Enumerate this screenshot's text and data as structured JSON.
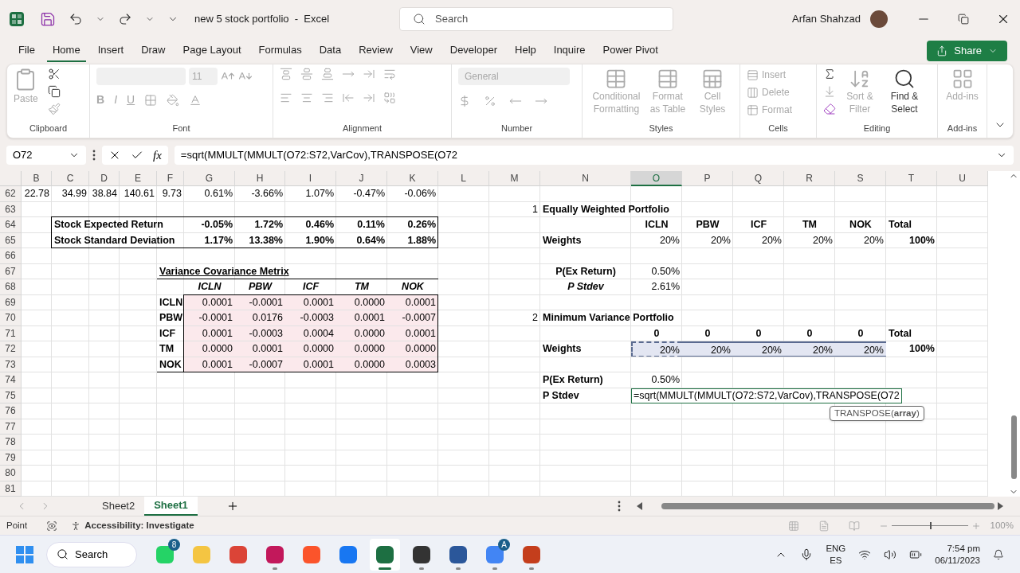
{
  "title_bar": {
    "title": "new 5 stock portfolio  -  Excel",
    "search": {
      "placeholder": "Search"
    },
    "user": "Arfan Shahzad"
  },
  "menu_tabs": [
    {
      "label": "File",
      "selected": false
    },
    {
      "label": "Home",
      "selected": true
    },
    {
      "label": "Insert",
      "selected": false
    },
    {
      "label": "Draw",
      "selected": false
    },
    {
      "label": "Page Layout",
      "selected": false
    },
    {
      "label": "Formulas",
      "selected": false
    },
    {
      "label": "Data",
      "selected": false
    },
    {
      "label": "Review",
      "selected": false
    },
    {
      "label": "View",
      "selected": false
    },
    {
      "label": "Developer",
      "selected": false
    },
    {
      "label": "Help",
      "selected": false
    },
    {
      "label": "Inquire",
      "selected": false
    },
    {
      "label": "Power Pivot",
      "selected": false
    }
  ],
  "share": {
    "label": "Share"
  },
  "ribbon": {
    "clipboard": {
      "label": "Clipboard",
      "paste": {
        "label": "Paste",
        "disabled": true
      }
    },
    "font": {
      "label": "Font",
      "size": "11",
      "bold": "B",
      "italic": "I",
      "underline": "U",
      "disabled": true
    },
    "alignment": {
      "label": "Alignment",
      "disabled": true
    },
    "number": {
      "label": "Number",
      "format": "General",
      "disabled": true
    },
    "styles": {
      "label": "Styles",
      "buttons": [
        {
          "label": "Conditional Formatting",
          "disabled": true
        },
        {
          "label": "Format as Table",
          "disabled": true
        },
        {
          "label": "Cell Styles",
          "disabled": true
        }
      ]
    },
    "cells": {
      "label": "Cells",
      "buttons": [
        {
          "label": "Insert",
          "disabled": true
        },
        {
          "label": "Delete",
          "disabled": true
        },
        {
          "label": "Format",
          "disabled": true
        }
      ]
    },
    "editing": {
      "label": "Editing",
      "buttons": [
        {
          "label": "Sort & Filter",
          "disabled": true
        },
        {
          "label": "Find & Select",
          "disabled": false
        }
      ]
    },
    "addins": {
      "label": "Add-ins",
      "buttons": [
        {
          "label": "Add-ins",
          "disabled": true
        }
      ]
    }
  },
  "formula_bar": {
    "name_box": "O72",
    "function_label": "fx",
    "formula": "=sqrt(MMULT(MMULT(O72:S72,VarCov),TRANSPOSE(O72"
  },
  "grid": {
    "columns": [
      {
        "label": "B",
        "selected": false
      },
      {
        "label": "C",
        "selected": false
      },
      {
        "label": "D",
        "selected": false
      },
      {
        "label": "E",
        "selected": false
      },
      {
        "label": "F",
        "selected": false
      },
      {
        "label": "G",
        "selected": false
      },
      {
        "label": "H",
        "selected": false
      },
      {
        "label": "I",
        "selected": false
      },
      {
        "label": "J",
        "selected": false
      },
      {
        "label": "K",
        "selected": false
      },
      {
        "label": "L",
        "selected": false
      },
      {
        "label": "M",
        "selected": false
      },
      {
        "label": "N",
        "selected": false
      },
      {
        "label": "O",
        "selected": true
      },
      {
        "label": "P",
        "selected": false
      },
      {
        "label": "Q",
        "selected": false
      },
      {
        "label": "R",
        "selected": false
      },
      {
        "label": "S",
        "selected": false
      },
      {
        "label": "T",
        "selected": false
      },
      {
        "label": "U",
        "selected": false
      }
    ],
    "rows": [
      {
        "number": "62",
        "cells": [
          {
            "text": "22.78",
            "kind": "value",
            "selected": false
          },
          {
            "text": "34.99",
            "kind": "value",
            "selected": false
          },
          {
            "text": "38.84",
            "kind": "value",
            "selected": false
          },
          {
            "text": "140.61",
            "kind": "value",
            "selected": false
          },
          {
            "text": "9.73",
            "kind": "value",
            "selected": false
          },
          {
            "text": "0.61%",
            "kind": "value",
            "selected": false
          },
          {
            "text": "-3.66%",
            "kind": "value",
            "selected": false
          },
          {
            "text": "1.07%",
            "kind": "value",
            "selected": false
          },
          {
            "text": "-0.47%",
            "kind": "value",
            "selected": false
          },
          {
            "text": "-0.06%",
            "kind": "value",
            "selected": false
          },
          null,
          null,
          null,
          null,
          null,
          null,
          null,
          null,
          null,
          null
        ]
      },
      {
        "number": "63",
        "cells": [
          null,
          null,
          null,
          null,
          null,
          null,
          null,
          null,
          null,
          null,
          null,
          {
            "text": "1",
            "kind": "value",
            "selected": false
          },
          {
            "text": "Equally Weighted Portfolio",
            "kind": "label",
            "selected": false
          },
          null,
          null,
          null,
          null,
          null,
          null,
          null
        ]
      },
      {
        "number": "64",
        "cells": [
          null,
          {
            "text": "Stock Expected Return",
            "kind": "label",
            "selected": false
          },
          null,
          null,
          null,
          {
            "text": "-0.05%",
            "kind": "bold_value",
            "selected": false
          },
          {
            "text": "1.72%",
            "kind": "bold_value",
            "selected": false
          },
          {
            "text": "0.46%",
            "kind": "bold_value",
            "selected": false
          },
          {
            "text": "0.11%",
            "kind": "bold_value",
            "selected": false
          },
          {
            "text": "0.26%",
            "kind": "bold_value",
            "selected": false
          },
          null,
          null,
          null,
          {
            "text": "ICLN",
            "kind": "center_bold",
            "selected": false
          },
          {
            "text": "PBW",
            "kind": "center_bold",
            "selected": false
          },
          {
            "text": "ICF",
            "kind": "center_bold",
            "selected": false
          },
          {
            "text": "TM",
            "kind": "center_bold",
            "selected": false
          },
          {
            "text": "NOK",
            "kind": "center_bold",
            "selected": false
          },
          {
            "text": "Total",
            "kind": "label",
            "selected": false
          },
          null
        ]
      },
      {
        "number": "65",
        "cells": [
          null,
          {
            "text": "Stock Standard Deviation",
            "kind": "label",
            "selected": false
          },
          null,
          null,
          null,
          {
            "text": "1.17%",
            "kind": "bold_value",
            "selected": false
          },
          {
            "text": "13.38%",
            "kind": "bold_value",
            "selected": false
          },
          {
            "text": "1.90%",
            "kind": "bold_value",
            "selected": false
          },
          {
            "text": "0.64%",
            "kind": "bold_value",
            "selected": false
          },
          {
            "text": "1.88%",
            "kind": "bold_value",
            "selected": false
          },
          null,
          null,
          {
            "text": "Weights",
            "kind": "label",
            "selected": false
          },
          {
            "text": "20%",
            "kind": "value",
            "selected": false
          },
          {
            "text": "20%",
            "kind": "value",
            "selected": false
          },
          {
            "text": "20%",
            "kind": "value",
            "selected": false
          },
          {
            "text": "20%",
            "kind": "value",
            "selected": false
          },
          {
            "text": "20%",
            "kind": "value",
            "selected": false
          },
          {
            "text": "100%",
            "kind": "bold_value",
            "selected": false
          },
          null
        ]
      },
      {
        "number": "66"
      },
      {
        "number": "67",
        "cells": [
          null,
          null,
          null,
          null,
          {
            "text": "Variance Covariance Metrix",
            "kind": "title",
            "selected": false
          },
          null,
          null,
          null,
          null,
          null,
          null,
          null,
          {
            "text": "P(Ex Return)",
            "kind": "center_bold",
            "selected": false
          },
          {
            "text": "0.50%",
            "kind": "value",
            "selected": false
          },
          null,
          null,
          null,
          null,
          null,
          null
        ]
      },
      {
        "number": "68",
        "cells": [
          null,
          null,
          null,
          null,
          null,
          {
            "text": "ICLN",
            "kind": "col_head",
            "selected": false
          },
          {
            "text": "PBW",
            "kind": "col_head",
            "selected": false
          },
          {
            "text": "ICF",
            "kind": "col_head",
            "selected": false
          },
          {
            "text": "TM",
            "kind": "col_head",
            "selected": false
          },
          {
            "text": "NOK",
            "kind": "col_head",
            "selected": false
          },
          null,
          null,
          {
            "text": "P Stdev",
            "kind": "col_head",
            "selected": false
          },
          {
            "text": "2.61%",
            "kind": "value",
            "selected": false
          },
          null,
          null,
          null,
          null,
          null,
          null
        ]
      },
      {
        "number": "69",
        "cells": [
          null,
          null,
          null,
          null,
          {
            "text": "ICLN",
            "kind": "label",
            "selected": false
          },
          {
            "text": "0.0001",
            "kind": "matrix_value",
            "selected": false
          },
          {
            "text": "-0.0001",
            "kind": "matrix_value",
            "selected": false
          },
          {
            "text": "0.0001",
            "kind": "matrix_value",
            "selected": false
          },
          {
            "text": "0.0000",
            "kind": "matrix_value",
            "selected": false
          },
          {
            "text": "0.0001",
            "kind": "matrix_value",
            "selected": false
          },
          null,
          null,
          null,
          null,
          null,
          null,
          null,
          null,
          null,
          null
        ]
      },
      {
        "number": "70",
        "cells": [
          null,
          null,
          null,
          null,
          {
            "text": "PBW",
            "kind": "label",
            "selected": false
          },
          {
            "text": "-0.0001",
            "kind": "matrix_value",
            "selected": false
          },
          {
            "text": "0.0176",
            "kind": "matrix_value",
            "selected": false
          },
          {
            "text": "-0.0003",
            "kind": "matrix_value",
            "selected": false
          },
          {
            "text": "0.0001",
            "kind": "matrix_value",
            "selected": false
          },
          {
            "text": "-0.0007",
            "kind": "matrix_value",
            "selected": false
          },
          null,
          {
            "text": "2",
            "kind": "value",
            "selected": false
          },
          {
            "text": "Minimum Variance Portfolio",
            "kind": "label",
            "selected": false
          },
          null,
          null,
          null,
          null,
          null,
          null,
          null
        ]
      },
      {
        "number": "71",
        "cells": [
          null,
          null,
          null,
          null,
          {
            "text": "ICF",
            "kind": "label",
            "selected": false
          },
          {
            "text": "0.0001",
            "kind": "matrix_value",
            "selected": false
          },
          {
            "text": "-0.0003",
            "kind": "matrix_value",
            "selected": false
          },
          {
            "text": "0.0004",
            "kind": "matrix_value",
            "selected": false
          },
          {
            "text": "0.0000",
            "kind": "matrix_value",
            "selected": false
          },
          {
            "text": "0.0001",
            "kind": "matrix_value",
            "selected": false
          },
          null,
          null,
          null,
          {
            "text": "0",
            "kind": "center_bold",
            "selected": false
          },
          {
            "text": "0",
            "kind": "center_bold",
            "selected": false
          },
          {
            "text": "0",
            "kind": "center_bold",
            "selected": false
          },
          {
            "text": "0",
            "kind": "center_bold",
            "selected": false
          },
          {
            "text": "0",
            "kind": "center_bold",
            "selected": false
          },
          {
            "text": "Total",
            "kind": "label",
            "selected": false
          },
          null
        ]
      },
      {
        "number": "72",
        "cells": [
          null,
          null,
          null,
          null,
          {
            "text": "TM",
            "kind": "label",
            "selected": false
          },
          {
            "text": "0.0000",
            "kind": "matrix_value",
            "selected": false
          },
          {
            "text": "0.0001",
            "kind": "matrix_value",
            "selected": false
          },
          {
            "text": "0.0000",
            "kind": "matrix_value",
            "selected": false
          },
          {
            "text": "0.0000",
            "kind": "matrix_value",
            "selected": false
          },
          {
            "text": "0.0000",
            "kind": "matrix_value",
            "selected": false
          },
          null,
          null,
          {
            "text": "Weights",
            "kind": "label",
            "selected": false
          },
          {
            "text": "20%",
            "kind": "value",
            "selected": true
          },
          {
            "text": "20%",
            "kind": "value",
            "selected": true
          },
          {
            "text": "20%",
            "kind": "value",
            "selected": true
          },
          {
            "text": "20%",
            "kind": "value",
            "selected": true
          },
          {
            "text": "20%",
            "kind": "value",
            "selected": true
          },
          {
            "text": "100%",
            "kind": "bold_value",
            "selected": false
          },
          null
        ]
      },
      {
        "number": "73",
        "cells": [
          null,
          null,
          null,
          null,
          {
            "text": "NOK",
            "kind": "label",
            "selected": false
          },
          {
            "text": "0.0001",
            "kind": "matrix_value",
            "selected": false
          },
          {
            "text": "-0.0007",
            "kind": "matrix_value",
            "selected": false
          },
          {
            "text": "0.0001",
            "kind": "matrix_value",
            "selected": false
          },
          {
            "text": "0.0000",
            "kind": "matrix_value",
            "selected": false
          },
          {
            "text": "0.0003",
            "kind": "matrix_value",
            "selected": false
          },
          null,
          null,
          null,
          null,
          null,
          null,
          null,
          null,
          null,
          null
        ]
      },
      {
        "number": "74",
        "cells": [
          null,
          null,
          null,
          null,
          null,
          null,
          null,
          null,
          null,
          null,
          null,
          null,
          {
            "text": "P(Ex Return)",
            "kind": "label",
            "selected": false
          },
          {
            "text": "0.50%",
            "kind": "value",
            "selected": false
          },
          null,
          null,
          null,
          null,
          null,
          null
        ]
      },
      {
        "number": "75",
        "cells": [
          null,
          null,
          null,
          null,
          null,
          null,
          null,
          null,
          null,
          null,
          null,
          null,
          {
            "text": "P Stdev",
            "kind": "label",
            "selected": false
          },
          {
            "text": "=sqrt(MMULT(MMULT(O72:S72,VarCov),TRANSPOSE(O72",
            "kind": "formula",
            "tip": "TRANSPOSE(**array**)",
            "selected": false
          },
          null,
          null,
          null,
          null,
          null,
          null
        ]
      },
      {
        "number": "76"
      },
      {
        "number": "77"
      },
      {
        "number": "78"
      },
      {
        "number": "79"
      },
      {
        "number": "80"
      },
      {
        "number": "81"
      }
    ]
  },
  "sheet_tabs": [
    {
      "label": "Sheet2",
      "selected": false
    },
    {
      "label": "Sheet1",
      "selected": true
    }
  ],
  "status_bar": {
    "mode": "Point",
    "accessibility": "Accessibility: Investigate",
    "zoom": {
      "level": 0.5,
      "reading": "100%"
    }
  },
  "taskbar": {
    "search": "Search",
    "apps": [
      {
        "color": "#25d366",
        "badge": "8",
        "running": false,
        "active": false
      },
      {
        "color": "#f4c542",
        "running": false,
        "active": false
      },
      {
        "color": "#db4437",
        "running": false,
        "active": false
      },
      {
        "color": "#c2185b",
        "running": true,
        "active": false
      },
      {
        "color": "#fb542b",
        "running": false,
        "active": false
      },
      {
        "color": "#1877f2",
        "running": false,
        "active": false
      },
      {
        "color": "#1d6f42",
        "running": true,
        "active": true
      },
      {
        "color": "#333333",
        "running": true,
        "active": false
      },
      {
        "color": "#2b579a",
        "running": true,
        "active": false
      },
      {
        "color": "#4285f4",
        "badge": "A",
        "running": true,
        "active": false
      },
      {
        "color": "#c43e1c",
        "running": true,
        "active": false
      }
    ],
    "language": "ENG",
    "layout": "ES",
    "time": "7:54 pm",
    "date": "06/11/2023"
  }
}
